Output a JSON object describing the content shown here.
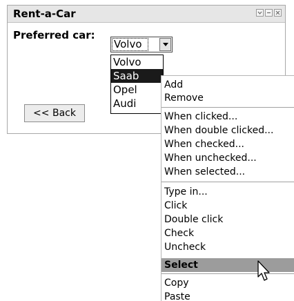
{
  "window": {
    "title": "Rent-a-Car",
    "controls": [
      "minimize-icon",
      "restore-icon",
      "close-icon"
    ]
  },
  "form": {
    "label": "Preferred car:",
    "select_value": "Volvo",
    "back_label": "<< Back"
  },
  "dropdown": {
    "options": [
      "Volvo",
      "Saab",
      "Opel",
      "Audi"
    ],
    "highlighted": "Saab"
  },
  "context_menu": {
    "group1": [
      "Add",
      "Remove"
    ],
    "group2": [
      "When clicked...",
      "When double clicked...",
      "When checked...",
      "When unchecked...",
      "When selected..."
    ],
    "group3": [
      "Type in...",
      "Click",
      "Double click",
      "Check",
      "Uncheck",
      "Select"
    ],
    "group4": [
      "Copy",
      "Paste"
    ],
    "highlighted": "Select"
  },
  "colors": {
    "titlebar": "#e6e6e6",
    "selection": "#1a1a1a",
    "menu_highlight": "#9c9c9c"
  }
}
